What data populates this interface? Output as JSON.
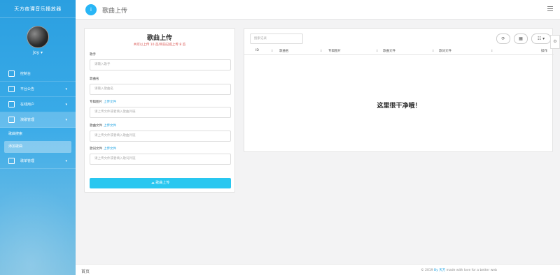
{
  "sidebar": {
    "title": "天方夜谭音乐播放器",
    "username": "Joy",
    "nav": [
      {
        "label": "控制台",
        "has_arrow": false
      },
      {
        "label": "平台公告",
        "has_arrow": true
      },
      {
        "label": "在线用户",
        "has_arrow": true
      },
      {
        "label": "演歌管理",
        "has_arrow": true
      }
    ],
    "sub_items": [
      "歌曲搜索",
      "添加歌曲"
    ],
    "last_nav": "歌单管理"
  },
  "header": {
    "badge": "i",
    "title": "歌曲上传"
  },
  "upload_form": {
    "title": "歌曲上传",
    "subtitle": "共可以上传 10 首/目前已提上传 8 首",
    "fields": [
      {
        "label": "歌手",
        "link": "",
        "placeholder": "请输入歌手"
      },
      {
        "label": "歌曲名",
        "link": "",
        "placeholder": "请输入歌曲名"
      },
      {
        "label": "专辑图片",
        "link": "上传文件",
        "placeholder": "请上传文件或者填入歌曲外链"
      },
      {
        "label": "歌曲文件",
        "link": "上传文件",
        "placeholder": "请上传文件或者填入歌曲外链"
      },
      {
        "label": "歌词文件",
        "link": "上传文件",
        "placeholder": "请上传文件或者填入歌词外链"
      }
    ],
    "submit_label": "☁ 歌曲上传"
  },
  "table": {
    "search_placeholder": "搜索记录",
    "toolbar": [
      "⟳",
      "▦",
      "☷ ▾"
    ],
    "columns": [
      "ID",
      "歌曲名",
      "专辑图片",
      "歌曲文件",
      "歌词文件",
      "操作"
    ],
    "empty_text": "这里很干净哦！"
  },
  "footer": {
    "left": "首页",
    "right_prefix": "© 2019",
    "right_link": "By 天方",
    "right_suffix": "made with love for a better web"
  }
}
